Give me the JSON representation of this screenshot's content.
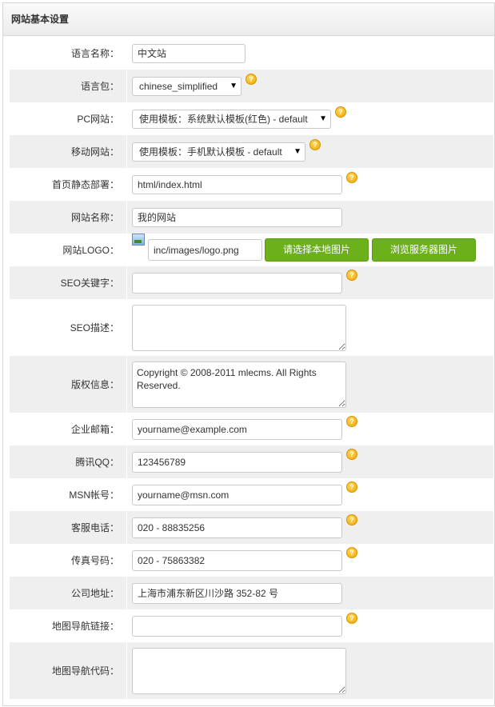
{
  "panel": {
    "title": "网站基本设置"
  },
  "fields": {
    "language_name": {
      "label": "语言名称：",
      "value": "中文站"
    },
    "language_pack": {
      "label": "语言包：",
      "value": "chinese_simplified"
    },
    "pc_site": {
      "label": "PC网站：",
      "value": "使用模板：系统默认模板(红色) - default"
    },
    "mobile_site": {
      "label": "移动网站：",
      "value": "使用模板：手机默认模板 - default"
    },
    "home_static": {
      "label": "首页静态部署：",
      "value": "html/index.html"
    },
    "site_name": {
      "label": "网站名称：",
      "value": "我的网站"
    },
    "site_logo": {
      "label": "网站LOGO：",
      "value": "inc/images/logo.png",
      "btn_local": "请选择本地图片",
      "btn_server": "浏览服务器图片"
    },
    "seo_keywords": {
      "label": "SEO关键字：",
      "value": ""
    },
    "seo_desc": {
      "label": "SEO描述：",
      "value": ""
    },
    "copyright": {
      "label": "版权信息：",
      "value": "Copyright © 2008-2011 mlecms. All Rights Reserved."
    },
    "email": {
      "label": "企业邮箱：",
      "value": "yourname@example.com"
    },
    "qq": {
      "label": "腾讯QQ：",
      "value": "123456789"
    },
    "msn": {
      "label": "MSN帐号：",
      "value": "yourname@msn.com"
    },
    "phone": {
      "label": "客服电话：",
      "value": "020 - 88835256"
    },
    "fax": {
      "label": "传真号码：",
      "value": "020 - 75863382"
    },
    "address": {
      "label": "公司地址：",
      "value": "上海市浦东新区川沙路 352-82 号"
    },
    "map_link": {
      "label": "地图导航链接：",
      "value": ""
    },
    "map_code": {
      "label": "地图导航代码：",
      "value": ""
    }
  },
  "icons": {
    "help": "help-icon",
    "dropdown": "chevron-down-icon",
    "image": "image-icon"
  },
  "colors": {
    "accent_green": "#6cb01c",
    "row_alt": "#efefef",
    "help_orange": "#f0a800"
  }
}
